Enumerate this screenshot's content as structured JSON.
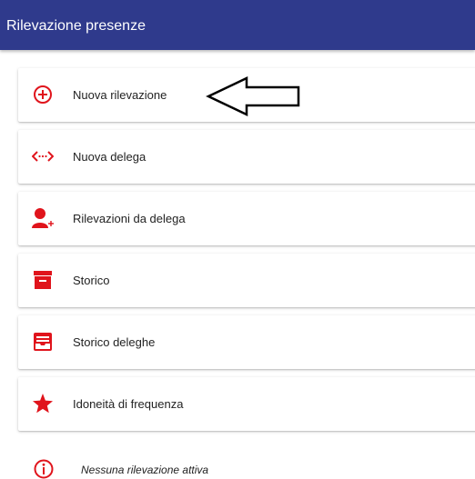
{
  "header": {
    "title": "Rilevazione presenze",
    "color": "#2f3a8c"
  },
  "menu": {
    "accent_color": "#e0141c",
    "items": [
      {
        "label": "Nuova rilevazione",
        "icon": "plus-circle-icon"
      },
      {
        "label": "Nuova delega",
        "icon": "code-arrows-icon"
      },
      {
        "label": "Rilevazioni da delega",
        "icon": "person-plus-icon"
      },
      {
        "label": "Storico",
        "icon": "archive-icon"
      },
      {
        "label": "Storico deleghe",
        "icon": "inbox-tray-icon"
      },
      {
        "label": "Idoneità di frequenza",
        "icon": "star-icon"
      }
    ]
  },
  "status": {
    "text": "Nessuna rilevazione attiva",
    "icon": "info-icon"
  },
  "annotation": {
    "icon": "pointer-arrow-icon"
  }
}
